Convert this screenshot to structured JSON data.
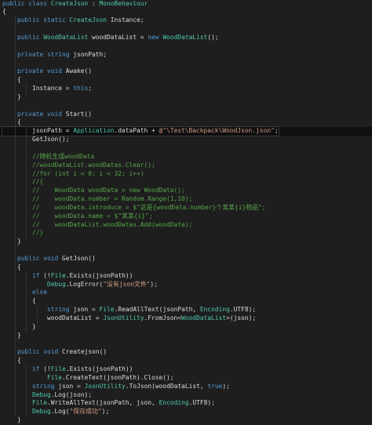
{
  "code_editor": {
    "lines": [
      [
        [
          "kw",
          "public class "
        ],
        [
          "ty",
          "CreateJson"
        ],
        [
          "tx",
          " : "
        ],
        [
          "ty",
          "MonoBehaviour"
        ]
      ],
      [
        [
          "tx",
          "{"
        ]
      ],
      [
        [
          "tx",
          "    "
        ],
        [
          "kw",
          "public static "
        ],
        [
          "ty",
          "CreateJson"
        ],
        [
          "tx",
          " Instance;"
        ]
      ],
      [],
      [
        [
          "tx",
          "    "
        ],
        [
          "kw",
          "public "
        ],
        [
          "ty",
          "WoodDataList"
        ],
        [
          "tx",
          " woodDataList = "
        ],
        [
          "kw",
          "new "
        ],
        [
          "ty",
          "WoodDataList"
        ],
        [
          "tx",
          "();"
        ]
      ],
      [],
      [
        [
          "tx",
          "    "
        ],
        [
          "kw",
          "private string "
        ],
        [
          "tx",
          "jsonPath;"
        ]
      ],
      [],
      [
        [
          "tx",
          "    "
        ],
        [
          "kw",
          "private void "
        ],
        [
          "tx",
          "Awake()"
        ]
      ],
      [
        [
          "tx",
          "    {"
        ]
      ],
      [
        [
          "tx",
          "        Instance = "
        ],
        [
          "kw",
          "this"
        ],
        [
          "tx",
          ";"
        ]
      ],
      [
        [
          "tx",
          "    }"
        ]
      ],
      [],
      [
        [
          "tx",
          "    "
        ],
        [
          "kw",
          "private void "
        ],
        [
          "tx",
          "Start()"
        ]
      ],
      [
        [
          "tx",
          "    {"
        ]
      ],
      [
        [
          "tx",
          "        jsonPath = "
        ],
        [
          "ty",
          "Application"
        ],
        [
          "tx",
          ".dataPath + "
        ],
        [
          "st",
          "@\"\\Test\\Backpack\\WoodJson.json\""
        ],
        [
          "tx",
          ";"
        ]
      ],
      [
        [
          "tx",
          "        GetJson();"
        ]
      ],
      [],
      [
        [
          "tx",
          "        "
        ],
        [
          "cm",
          "//随机生成woodData"
        ]
      ],
      [
        [
          "tx",
          "        "
        ],
        [
          "cm",
          "//woodDataList.woodDatas.Clear();"
        ]
      ],
      [
        [
          "tx",
          "        "
        ],
        [
          "cm",
          "//for (int i = 0; i < 32; i++)"
        ]
      ],
      [
        [
          "tx",
          "        "
        ],
        [
          "cm",
          "//{"
        ]
      ],
      [
        [
          "tx",
          "        "
        ],
        [
          "cm",
          "//    WoodData woodData = new WoodData();"
        ]
      ],
      [
        [
          "tx",
          "        "
        ],
        [
          "cm",
          "//    woodData.number = Random.Range(1,10);"
        ]
      ],
      [
        [
          "tx",
          "        "
        ],
        [
          "cm",
          "//    woodData.introduce = $\"这是{woodData.number}个某某{i}物品\";"
        ]
      ],
      [
        [
          "tx",
          "        "
        ],
        [
          "cm",
          "//    woodData.name = $\"某某{i}\";"
        ]
      ],
      [
        [
          "tx",
          "        "
        ],
        [
          "cm",
          "//    woodDataList.woodDatas.Add(woodData);"
        ]
      ],
      [
        [
          "tx",
          "        "
        ],
        [
          "cm",
          "//}"
        ]
      ],
      [
        [
          "tx",
          "    }"
        ]
      ],
      [],
      [
        [
          "tx",
          "    "
        ],
        [
          "kw",
          "public void "
        ],
        [
          "tx",
          "GetJson()"
        ]
      ],
      [
        [
          "tx",
          "    {"
        ]
      ],
      [
        [
          "tx",
          "        "
        ],
        [
          "kw",
          "if "
        ],
        [
          "tx",
          "(!"
        ],
        [
          "ty",
          "File"
        ],
        [
          "tx",
          ".Exists(jsonPath))"
        ]
      ],
      [
        [
          "tx",
          "            "
        ],
        [
          "ty",
          "Debug"
        ],
        [
          "tx",
          ".LogError("
        ],
        [
          "st",
          "\"没有json文件\""
        ],
        [
          "tx",
          ");"
        ]
      ],
      [
        [
          "tx",
          "        "
        ],
        [
          "kw",
          "else"
        ]
      ],
      [
        [
          "tx",
          "        {"
        ]
      ],
      [
        [
          "tx",
          "            "
        ],
        [
          "kw",
          "string "
        ],
        [
          "tx",
          "json = "
        ],
        [
          "ty",
          "File"
        ],
        [
          "tx",
          ".ReadAllText(jsonPath, "
        ],
        [
          "ty",
          "Encoding"
        ],
        [
          "tx",
          ".UTF8);"
        ]
      ],
      [
        [
          "tx",
          "            woodDataList = "
        ],
        [
          "ty",
          "JsonUtility"
        ],
        [
          "tx",
          ".FromJson<"
        ],
        [
          "ty",
          "WoodDataList"
        ],
        [
          "tx",
          ">(json);"
        ]
      ],
      [
        [
          "tx",
          "        }"
        ]
      ],
      [
        [
          "tx",
          "    }"
        ]
      ],
      [],
      [
        [
          "tx",
          "    "
        ],
        [
          "kw",
          "public void "
        ],
        [
          "tx",
          "Createjson()"
        ]
      ],
      [
        [
          "tx",
          "    {"
        ]
      ],
      [
        [
          "tx",
          "        "
        ],
        [
          "kw",
          "if "
        ],
        [
          "tx",
          "(!"
        ],
        [
          "ty",
          "File"
        ],
        [
          "tx",
          ".Exists(jsonPath))"
        ]
      ],
      [
        [
          "tx",
          "            "
        ],
        [
          "ty",
          "File"
        ],
        [
          "tx",
          ".CreateText(jsonPath).Close();"
        ]
      ],
      [
        [
          "tx",
          "        "
        ],
        [
          "kw",
          "string "
        ],
        [
          "tx",
          "json = "
        ],
        [
          "ty",
          "JsonUtility"
        ],
        [
          "tx",
          ".ToJson(woodDataList, "
        ],
        [
          "kw",
          "true"
        ],
        [
          "tx",
          ");"
        ]
      ],
      [
        [
          "tx",
          "        "
        ],
        [
          "ty",
          "Debug"
        ],
        [
          "tx",
          ".Log(json);"
        ]
      ],
      [
        [
          "tx",
          "        "
        ],
        [
          "ty",
          "File"
        ],
        [
          "tx",
          ".WriteAllText(jsonPath, json, "
        ],
        [
          "ty",
          "Encoding"
        ],
        [
          "tx",
          ".UTF8);"
        ]
      ],
      [
        [
          "tx",
          "        "
        ],
        [
          "ty",
          "Debug"
        ],
        [
          "tx",
          ".Log("
        ],
        [
          "st",
          "\"保存成功\""
        ],
        [
          "tx",
          ");"
        ]
      ],
      [
        [
          "tx",
          "    }"
        ]
      ]
    ]
  }
}
